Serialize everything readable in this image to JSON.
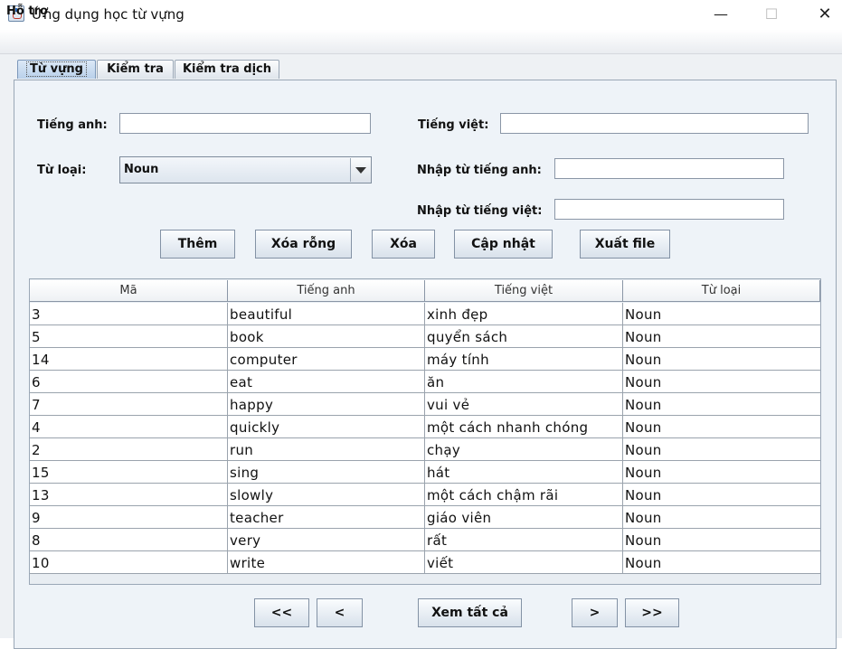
{
  "window": {
    "title": "Ứng dụng học từ vựng",
    "minimize": "—",
    "maximize": "☐",
    "close": "✕"
  },
  "menu": {
    "help": "Hỗ trợ"
  },
  "tabs": [
    "Từ vựng",
    "Kiểm tra",
    "Kiểm tra dịch"
  ],
  "form": {
    "english_label": "Tiếng anh:",
    "english_value": "",
    "vietnamese_label": "Tiếng việt:",
    "vietnamese_value": "",
    "type_label": "Từ loại:",
    "type_selected": "Noun",
    "search_en_label": "Nhập từ tiếng anh:",
    "search_en_value": "",
    "search_vi_label": "Nhập từ tiếng việt:",
    "search_vi_value": ""
  },
  "actions": [
    "Thêm",
    "Xóa rỗng",
    "Xóa",
    "Cập nhật",
    "Xuất file"
  ],
  "table": {
    "headers": [
      "Mã",
      "Tiếng anh",
      "Tiếng việt",
      "Từ loại"
    ],
    "rows": [
      [
        "3",
        "beautiful",
        "xinh đẹp",
        "Noun"
      ],
      [
        "5",
        "book",
        "quyển sách",
        "Noun"
      ],
      [
        "14",
        "computer",
        "máy tính",
        "Noun"
      ],
      [
        "6",
        "eat",
        "ăn",
        "Noun"
      ],
      [
        "7",
        "happy",
        "vui vẻ",
        "Noun"
      ],
      [
        "4",
        "quickly",
        "một cách nhanh chóng",
        "Noun"
      ],
      [
        "2",
        "run",
        "chạy",
        "Noun"
      ],
      [
        "15",
        "sing",
        "hát",
        "Noun"
      ],
      [
        "13",
        "slowly",
        "một cách chậm rãi",
        "Noun"
      ],
      [
        "9",
        "teacher",
        "giáo viên",
        "Noun"
      ],
      [
        "8",
        "very",
        "rất",
        "Noun"
      ],
      [
        "10",
        "write",
        "viết",
        "Noun"
      ]
    ]
  },
  "pagination": {
    "first": "<<",
    "prev": "<",
    "show_all": "Xem tất cả",
    "next": ">",
    "last": ">>"
  }
}
